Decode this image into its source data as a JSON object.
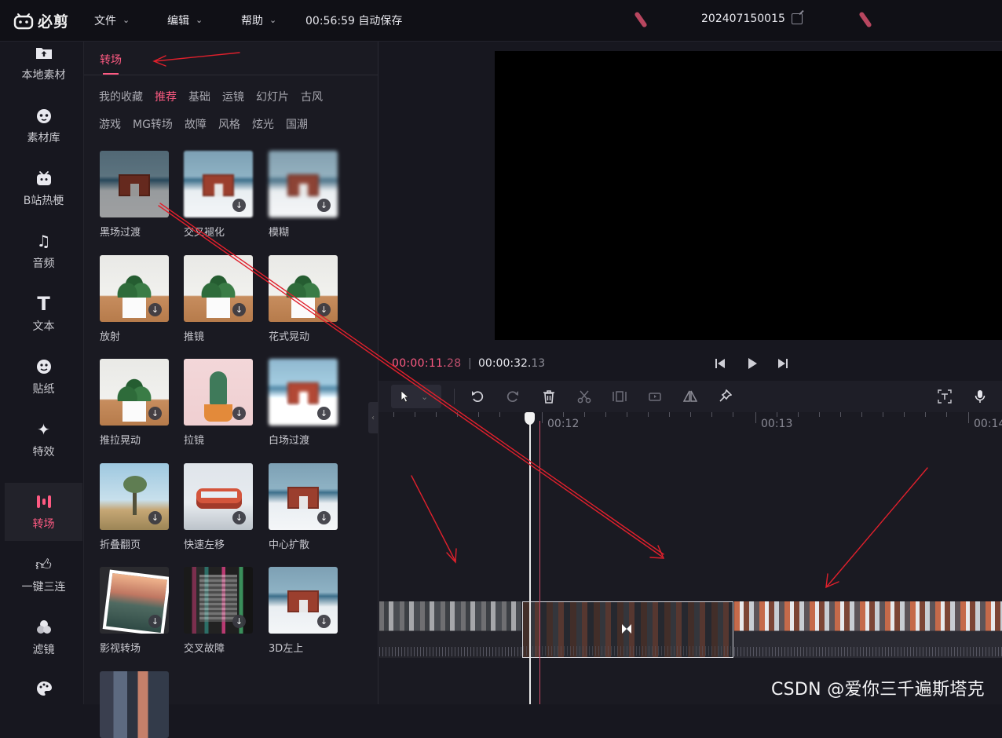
{
  "app": {
    "name": "必剪"
  },
  "menu": [
    {
      "label": "文件"
    },
    {
      "label": "编辑"
    },
    {
      "label": "帮助"
    }
  ],
  "autosave": "00:56:59 自动保存",
  "project": {
    "title": "202407150015"
  },
  "rail": [
    {
      "label": "本地素材",
      "icon": "upload-folder-icon"
    },
    {
      "label": "素材库",
      "icon": "library-icon"
    },
    {
      "label": "B站热梗",
      "icon": "bilibili-tv-icon"
    },
    {
      "label": "音频",
      "icon": "music-note-icon"
    },
    {
      "label": "文本",
      "icon": "text-t-icon"
    },
    {
      "label": "贴纸",
      "icon": "sticker-icon"
    },
    {
      "label": "特效",
      "icon": "effects-star-icon"
    },
    {
      "label": "转场",
      "icon": "transition-icon",
      "active": true
    },
    {
      "label": "一键三连",
      "icon": "thumbs-up-icon"
    },
    {
      "label": "滤镜",
      "icon": "filter-icon"
    }
  ],
  "panel": {
    "tab": "转场",
    "categories_row1": [
      "我的收藏",
      "推荐",
      "基础",
      "运镜",
      "幻灯片",
      "古风"
    ],
    "categories_row2": [
      "游戏",
      "MG转场",
      "故障",
      "风格",
      "炫光",
      "国潮"
    ],
    "active_category": "推荐",
    "items": [
      {
        "label": "黑场过渡",
        "download": false
      },
      {
        "label": "交叉褪化",
        "download": true
      },
      {
        "label": "模糊",
        "download": true
      },
      {
        "label": "放射",
        "download": true
      },
      {
        "label": "推镜",
        "download": true
      },
      {
        "label": "花式晃动",
        "download": true
      },
      {
        "label": "推拉晃动",
        "download": true
      },
      {
        "label": "拉镜",
        "download": true
      },
      {
        "label": "白场过渡",
        "download": true
      },
      {
        "label": "折叠翻页",
        "download": true
      },
      {
        "label": "快速左移",
        "download": true
      },
      {
        "label": "中心扩散",
        "download": true
      },
      {
        "label": "影视转场",
        "download": true
      },
      {
        "label": "交叉故障",
        "download": true
      },
      {
        "label": "3D左上",
        "download": true
      }
    ]
  },
  "playback": {
    "current_main": "00:00:11.",
    "current_frac": "28",
    "separator": "|",
    "total_main": "00:00:32.",
    "total_frac": "13"
  },
  "timeline": {
    "ruler": [
      "00:12",
      "00:13",
      "00:14"
    ]
  },
  "watermark": "CSDN @爱你三千遍斯塔克",
  "colors": {
    "accent": "#fe5a82",
    "annotation": "#e0202c"
  }
}
